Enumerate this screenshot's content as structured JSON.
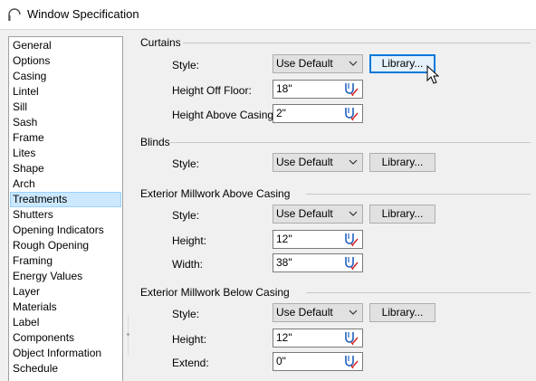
{
  "window": {
    "title": "Window Specification"
  },
  "nav": {
    "items": [
      "General",
      "Options",
      "Casing",
      "Lintel",
      "Sill",
      "Sash",
      "Frame",
      "Lites",
      "Shape",
      "Arch",
      "Treatments",
      "Shutters",
      "Opening Indicators",
      "Rough Opening",
      "Framing",
      "Energy Values",
      "Layer",
      "Materials",
      "Label",
      "Components",
      "Object Information",
      "Schedule"
    ],
    "selected": "Treatments"
  },
  "curtains": {
    "group_label": "Curtains",
    "style_label": "Style:",
    "style_value": "Use Default",
    "library_label": "Library...",
    "height_off_floor_label": "Height Off Floor:",
    "height_off_floor_value": "18\"",
    "height_above_casing_label": "Height Above Casing:",
    "height_above_casing_value": "2\""
  },
  "blinds": {
    "group_label": "Blinds",
    "style_label": "Style:",
    "style_value": "Use Default",
    "library_label": "Library..."
  },
  "millwork_above": {
    "group_label": "Exterior Millwork Above Casing",
    "style_label": "Style:",
    "style_value": "Use Default",
    "library_label": "Library...",
    "height_label": "Height:",
    "height_value": "12\"",
    "width_label": "Width:",
    "width_value": "38\""
  },
  "millwork_below": {
    "group_label": "Exterior Millwork Below Casing",
    "style_label": "Style:",
    "style_value": "Use Default",
    "library_label": "Library...",
    "height_label": "Height:",
    "height_value": "12\"",
    "extend_label": "Extend:",
    "extend_value": "0\""
  },
  "icons": {
    "app": "window-arch-icon",
    "dropdown": "chevron-down-icon",
    "dimension": "dimension-edit-icon",
    "cursor": "mouse-pointer-icon"
  },
  "colors": {
    "selection_bg": "#cce8ff",
    "selection_border": "#99d1ff",
    "focus_border": "#0078d7",
    "icon_blue": "#1f5fbf",
    "icon_red": "#d22020"
  }
}
